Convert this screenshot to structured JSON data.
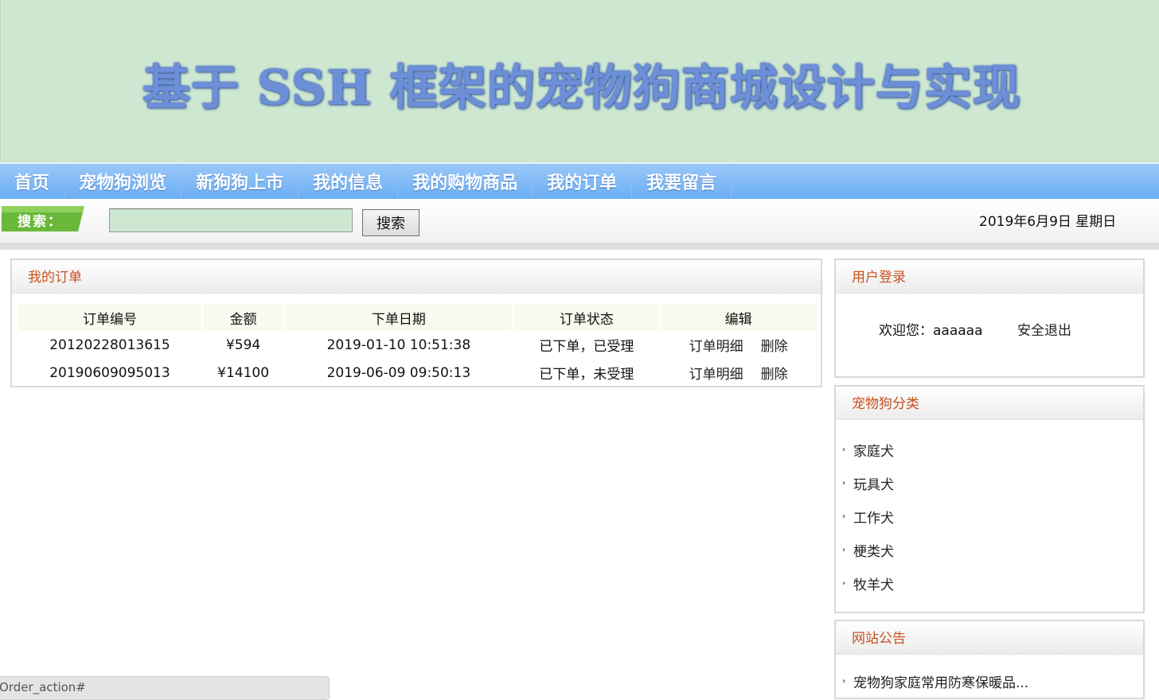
{
  "banner": {
    "title": "基于 SSH 框架的宠物狗商城设计与实现"
  },
  "nav": {
    "items": [
      "首页",
      "宠物狗浏览",
      "新狗狗上市",
      "我的信息",
      "我的购物商品",
      "我的订单",
      "我要留言"
    ]
  },
  "search": {
    "label": "搜索：",
    "input_value": "",
    "button": "搜索"
  },
  "date": "2019年6月9日 星期日",
  "orders": {
    "title": "我的订单",
    "columns": [
      "订单编号",
      "金额",
      "下单日期",
      "订单状态",
      "编辑"
    ],
    "rows": [
      {
        "id": "20120228013615",
        "amount": "¥594",
        "date": "2019-01-10 10:51:38",
        "status": "已下单，已受理",
        "detail": "订单明细",
        "delete": "删除"
      },
      {
        "id": "20190609095013",
        "amount": "¥14100",
        "date": "2019-06-09 09:50:13",
        "status": "已下单，未受理",
        "detail": "订单明细",
        "delete": "删除"
      }
    ]
  },
  "login": {
    "title": "用户登录",
    "welcome": "欢迎您：aaaaaa",
    "logout": "安全退出"
  },
  "categories": {
    "title": "宠物狗分类",
    "items": [
      "家庭犬",
      "玩具犬",
      "工作犬",
      "梗类犬",
      "牧羊犬"
    ]
  },
  "notice": {
    "title": "网站公告",
    "items": [
      "宠物狗家庭常用防寒保暖品..."
    ]
  },
  "statusbar": {
    "url": "Order_action#"
  },
  "colors": {
    "banner_bg": "#cde7d0",
    "nav_bg": "#7cb8f6",
    "panel_title": "#c8501e",
    "search_tag": "#6ab83a"
  }
}
